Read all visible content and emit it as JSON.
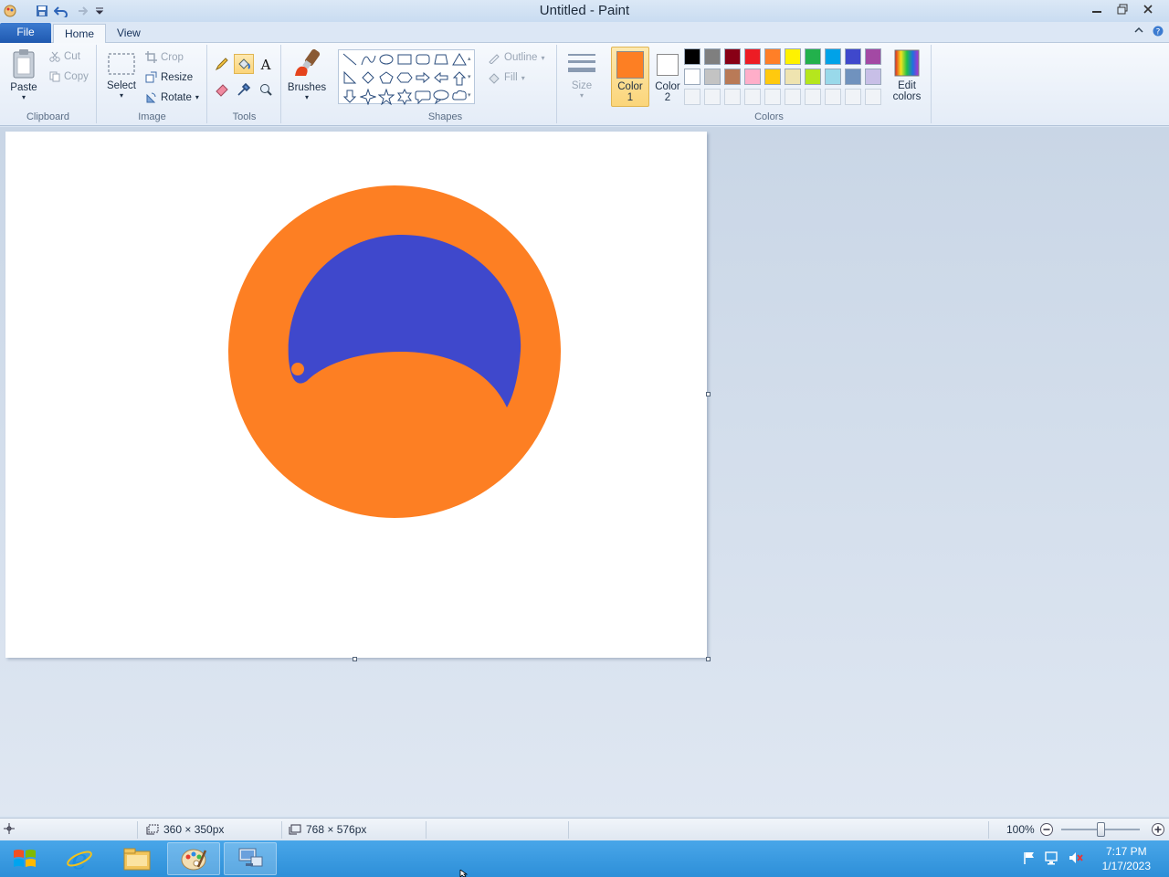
{
  "window": {
    "title": "Untitled - Paint"
  },
  "tabs": {
    "file": "File",
    "home": "Home",
    "view": "View"
  },
  "clipboard": {
    "paste": "Paste",
    "cut": "Cut",
    "copy": "Copy",
    "label": "Clipboard"
  },
  "image": {
    "select": "Select",
    "crop": "Crop",
    "resize": "Resize",
    "rotate": "Rotate",
    "label": "Image"
  },
  "tools": {
    "label": "Tools",
    "active_tool": "fill-icon"
  },
  "brushes": {
    "label": "Brushes"
  },
  "shapes": {
    "outline": "Outline",
    "fill": "Fill",
    "label": "Shapes"
  },
  "size": {
    "label": "Size"
  },
  "colors": {
    "color1_label": "Color",
    "color1_num": "1",
    "color2_label": "Color",
    "color2_num": "2",
    "color1_value": "#fd7f23",
    "color2_value": "#ffffff",
    "edit_label": "Edit",
    "edit_label2": "colors",
    "label": "Colors",
    "palette": [
      "#000000",
      "#7f7f7f",
      "#880015",
      "#ed1c24",
      "#ff7f27",
      "#fff200",
      "#22b14c",
      "#00a2e8",
      "#3f48cc",
      "#a349a4",
      "#ffffff",
      "#c3c3c3",
      "#b97a57",
      "#ffaec9",
      "#ffc90e",
      "#efe4b0",
      "#b5e61d",
      "#99d9ea",
      "#7092be",
      "#c8bfe7"
    ]
  },
  "drawing": {
    "outer_color": "#fd7f23",
    "inner_color": "#3f48cc"
  },
  "status": {
    "selection_size": "360 × 350px",
    "image_size": "768 × 576px",
    "zoom": "100%"
  },
  "clock": {
    "time": "7:17 PM",
    "date": "1/17/2023"
  }
}
